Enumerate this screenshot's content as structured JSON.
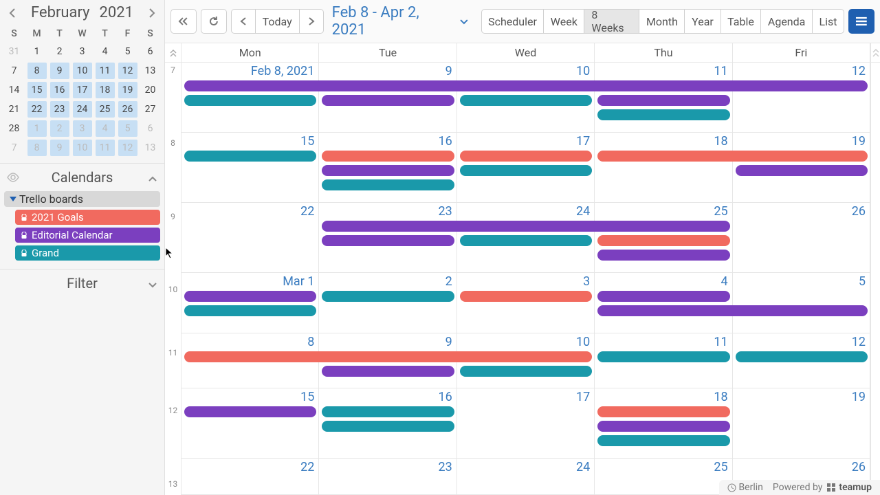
{
  "colors": {
    "purple": "#7b3fbf",
    "teal": "#1a99aa",
    "coral": "#f16a5f",
    "blue": "#3a7cc0"
  },
  "miniCal": {
    "month": "February",
    "year": "2021",
    "dow": [
      "S",
      "M",
      "T",
      "W",
      "T",
      "F",
      "S"
    ],
    "weeks": [
      [
        {
          "d": 31,
          "dim": true
        },
        {
          "d": 1
        },
        {
          "d": 2
        },
        {
          "d": 3
        },
        {
          "d": 4
        },
        {
          "d": 5
        },
        {
          "d": 6
        }
      ],
      [
        {
          "d": 7
        },
        {
          "d": 8,
          "r": true
        },
        {
          "d": 9,
          "r": true
        },
        {
          "d": 10,
          "r": true
        },
        {
          "d": 11,
          "r": true
        },
        {
          "d": 12,
          "r": true
        },
        {
          "d": 13
        }
      ],
      [
        {
          "d": 14
        },
        {
          "d": 15,
          "r": true
        },
        {
          "d": 16,
          "r": true
        },
        {
          "d": 17,
          "r": true
        },
        {
          "d": 18,
          "r": true
        },
        {
          "d": 19,
          "r": true
        },
        {
          "d": 20
        }
      ],
      [
        {
          "d": 21
        },
        {
          "d": 22,
          "r": true
        },
        {
          "d": 23,
          "r": true
        },
        {
          "d": 24,
          "r": true
        },
        {
          "d": 25,
          "r": true
        },
        {
          "d": 26,
          "r": true
        },
        {
          "d": 27
        }
      ],
      [
        {
          "d": 28
        },
        {
          "d": 1,
          "dim": true,
          "r": true
        },
        {
          "d": 2,
          "dim": true,
          "r": true
        },
        {
          "d": 3,
          "dim": true,
          "r": true
        },
        {
          "d": 4,
          "dim": true,
          "r": true
        },
        {
          "d": 5,
          "dim": true,
          "r": true
        },
        {
          "d": 6,
          "dim": true
        }
      ],
      [
        {
          "d": 7,
          "dim": true
        },
        {
          "d": 8,
          "dim": true,
          "r": true
        },
        {
          "d": 9,
          "dim": true,
          "r": true
        },
        {
          "d": 10,
          "dim": true,
          "r": true
        },
        {
          "d": 11,
          "dim": true,
          "r": true
        },
        {
          "d": 12,
          "dim": true,
          "r": true
        },
        {
          "d": 13,
          "dim": true
        }
      ]
    ]
  },
  "sidebar": {
    "calendars_label": "Calendars",
    "filter_label": "Filter",
    "group": "Trello boards",
    "items": [
      {
        "label": "2021 Goals",
        "color": "#f16a5f"
      },
      {
        "label": "Editorial Calendar",
        "color": "#7b3fbf"
      },
      {
        "label": "Grand",
        "color": "#1a99aa"
      }
    ]
  },
  "toolbar": {
    "today": "Today",
    "range": "Feb 8 - Apr 2, 2021",
    "views": [
      "Scheduler",
      "Week",
      "8 Weeks",
      "Month",
      "Year",
      "Table",
      "Agenda",
      "List"
    ],
    "active_view": 2
  },
  "grid": {
    "day_headers": [
      "Mon",
      "Tue",
      "Wed",
      "Thu",
      "Fri"
    ],
    "row_height_pct": [
      16.2,
      16.2,
      16.2,
      14.0,
      12.8,
      16.2,
      8.4
    ],
    "week_numbers": [
      "7",
      "8",
      "9",
      "10",
      "11",
      "12",
      "13"
    ],
    "rows": [
      {
        "dates": [
          "Feb 8, 2021",
          "9",
          "10",
          "11",
          "12"
        ],
        "events": [
          {
            "color": "purple",
            "start": 0,
            "span": 5,
            "track": 0
          },
          {
            "color": "teal",
            "start": 0,
            "span": 1,
            "track": 1
          },
          {
            "color": "purple",
            "start": 1,
            "span": 1,
            "track": 1
          },
          {
            "color": "teal",
            "start": 2,
            "span": 1,
            "track": 1
          },
          {
            "color": "purple",
            "start": 3,
            "span": 1,
            "track": 1
          },
          {
            "color": "teal",
            "start": 3,
            "span": 1,
            "track": 2
          }
        ]
      },
      {
        "dates": [
          "15",
          "16",
          "17",
          "18",
          "19"
        ],
        "events": [
          {
            "color": "teal",
            "start": 0,
            "span": 1,
            "track": 0
          },
          {
            "color": "coral",
            "start": 1,
            "span": 1,
            "track": 0
          },
          {
            "color": "coral",
            "start": 2,
            "span": 1,
            "track": 0
          },
          {
            "color": "coral",
            "start": 3,
            "span": 2,
            "track": 0
          },
          {
            "color": "purple",
            "start": 1,
            "span": 1,
            "track": 1
          },
          {
            "color": "teal",
            "start": 2,
            "span": 1,
            "track": 1
          },
          {
            "color": "purple",
            "start": 4,
            "span": 1,
            "track": 1
          },
          {
            "color": "teal",
            "start": 1,
            "span": 1,
            "track": 2
          }
        ]
      },
      {
        "dates": [
          "22",
          "23",
          "24",
          "25",
          "26"
        ],
        "events": [
          {
            "color": "purple",
            "start": 1,
            "span": 3,
            "track": 0
          },
          {
            "color": "purple",
            "start": 1,
            "span": 1,
            "track": 1
          },
          {
            "color": "teal",
            "start": 2,
            "span": 1,
            "track": 1
          },
          {
            "color": "coral",
            "start": 3,
            "span": 1,
            "track": 1
          },
          {
            "color": "purple",
            "start": 3,
            "span": 1,
            "track": 2
          }
        ]
      },
      {
        "dates": [
          "Mar 1",
          "2",
          "3",
          "4",
          "5"
        ],
        "events": [
          {
            "color": "purple",
            "start": 0,
            "span": 1,
            "track": 0
          },
          {
            "color": "teal",
            "start": 1,
            "span": 1,
            "track": 0
          },
          {
            "color": "coral",
            "start": 2,
            "span": 1,
            "track": 0
          },
          {
            "color": "purple",
            "start": 3,
            "span": 1,
            "track": 0
          },
          {
            "color": "teal",
            "start": 0,
            "span": 1,
            "track": 1
          },
          {
            "color": "purple",
            "start": 3,
            "span": 2,
            "track": 1
          }
        ]
      },
      {
        "dates": [
          "8",
          "9",
          "10",
          "11",
          "12"
        ],
        "events": [
          {
            "color": "coral",
            "start": 0,
            "span": 3,
            "track": 0
          },
          {
            "color": "teal",
            "start": 3,
            "span": 1,
            "track": 0
          },
          {
            "color": "teal",
            "start": 4,
            "span": 1,
            "track": 0
          },
          {
            "color": "purple",
            "start": 1,
            "span": 1,
            "track": 1
          },
          {
            "color": "teal",
            "start": 2,
            "span": 1,
            "track": 1
          }
        ]
      },
      {
        "dates": [
          "15",
          "16",
          "17",
          "18",
          "19"
        ],
        "events": [
          {
            "color": "purple",
            "start": 0,
            "span": 1,
            "track": 0
          },
          {
            "color": "teal",
            "start": 1,
            "span": 1,
            "track": 0
          },
          {
            "color": "coral",
            "start": 3,
            "span": 1,
            "track": 0
          },
          {
            "color": "teal",
            "start": 1,
            "span": 1,
            "track": 1
          },
          {
            "color": "purple",
            "start": 3,
            "span": 1,
            "track": 1
          },
          {
            "color": "teal",
            "start": 3,
            "span": 1,
            "track": 2
          }
        ]
      },
      {
        "dates": [
          "22",
          "23",
          "24",
          "25",
          "26"
        ],
        "events": []
      }
    ]
  },
  "footer": {
    "tz": "Berlin",
    "powered": "Powered by",
    "brand": "teamup"
  }
}
